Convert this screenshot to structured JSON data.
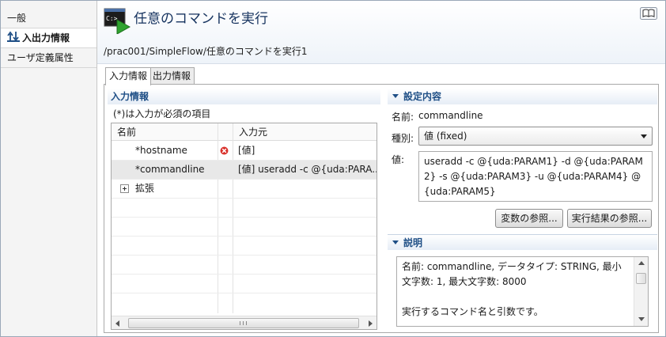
{
  "sidebar": {
    "items": [
      {
        "label": "一般"
      },
      {
        "label": "入出力情報"
      },
      {
        "label": "ユーザ定義属性"
      }
    ]
  },
  "header": {
    "icon_text": "C:>_",
    "title": "任意のコマンドを実行",
    "path": "/prac001/SimpleFlow/任意のコマンドを実行1"
  },
  "tabs": [
    {
      "label": "入力情報"
    },
    {
      "label": "出力情報"
    }
  ],
  "input_section": {
    "title": "入力情報",
    "required_note": "(*)は入力が必須の項目",
    "columns": [
      "名前",
      "入力元"
    ],
    "rows": [
      {
        "name": "*hostname",
        "source": "[値]"
      },
      {
        "name": "*commandline",
        "source": "[値] useradd -c @{uda:PARA..."
      },
      {
        "name": "拡張",
        "source": ""
      }
    ]
  },
  "settings_section": {
    "title": "設定内容",
    "name_label": "名前:",
    "name_value": "commandline",
    "type_label": "種別:",
    "type_value": "値 (fixed)",
    "value_label": "値:",
    "value_text": "useradd -c @{uda:PARAM1} -d @{uda:PARAM2} -s @{uda:PARAM3} -u @{uda:PARAM4} @{uda:PARAM5}",
    "btn_variables": "変数の参照...",
    "btn_results": "実行結果の参照..."
  },
  "description_section": {
    "title": "説明",
    "line1": "名前: commandline, データタイプ: STRING, 最小文字数: 1, 最大文字数: 8000",
    "line2": "実行するコマンド名と引数です。"
  },
  "colors": {
    "section_title": "#1f4f86",
    "page_title": "#15325e",
    "error": "#d9322c",
    "run_arrow": "#2fa32f"
  }
}
